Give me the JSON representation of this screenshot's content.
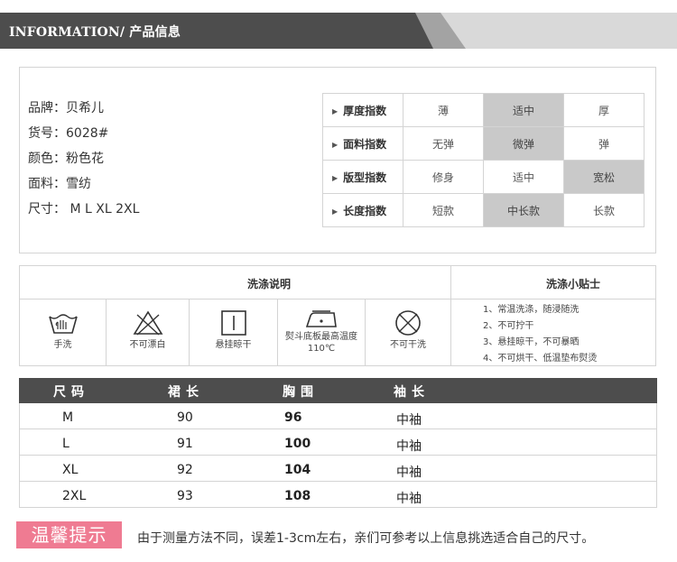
{
  "header": {
    "title": "INFORMATION/ 产品信息"
  },
  "info": {
    "items": [
      "品牌：贝希儿",
      "货号：6028#",
      "颜色：粉色花",
      "面料：雪纺",
      "尺寸： M  L  XL  2XL"
    ]
  },
  "indices": [
    {
      "label": "厚度指数",
      "options": [
        "薄",
        "适中",
        "厚"
      ],
      "selected": 1
    },
    {
      "label": "面料指数",
      "options": [
        "无弹",
        "微弹",
        "弹"
      ],
      "selected": 1
    },
    {
      "label": "版型指数",
      "options": [
        "修身",
        "适中",
        "宽松"
      ],
      "selected": 2
    },
    {
      "label": "长度指数",
      "options": [
        "短款",
        "中长款",
        "长款"
      ],
      "selected": 1
    }
  ],
  "wash": {
    "title": "洗涤说明",
    "tips_title": "洗涤小贴士",
    "icons": [
      {
        "name": "hand-wash-icon",
        "caption": "手洗"
      },
      {
        "name": "no-bleach-icon",
        "caption": "不可漂白"
      },
      {
        "name": "hang-dry-icon",
        "caption": "悬挂晾干"
      },
      {
        "name": "iron-icon",
        "caption": "熨斗底板最高温度110℃"
      },
      {
        "name": "no-dry-clean-icon",
        "caption": "不可干洗"
      }
    ],
    "tips": [
      "1、常温洗涤，随浸随洗",
      "2、不可拧干",
      "3、悬挂晾干，不可暴晒",
      "4、不可烘干、低温垫布熨烫"
    ]
  },
  "size_table": {
    "headers": [
      "尺码",
      "裙长",
      "胸围",
      "袖长"
    ],
    "rows": [
      [
        "M",
        "90",
        "96",
        "中袖"
      ],
      [
        "L",
        "91",
        "100",
        "中袖"
      ],
      [
        "XL",
        "92",
        "104",
        "中袖"
      ],
      [
        "2XL",
        "93",
        "108",
        "中袖"
      ]
    ]
  },
  "notice": {
    "badge": "温馨提示",
    "text": "由于测量方法不同，误差1-3cm左右，亲们可参考以上信息挑选适合自己的尺寸。"
  },
  "colors": {
    "banner_dark": "#4d4d4d",
    "highlight": "#c9c9c9",
    "badge": "#ef7b92"
  }
}
